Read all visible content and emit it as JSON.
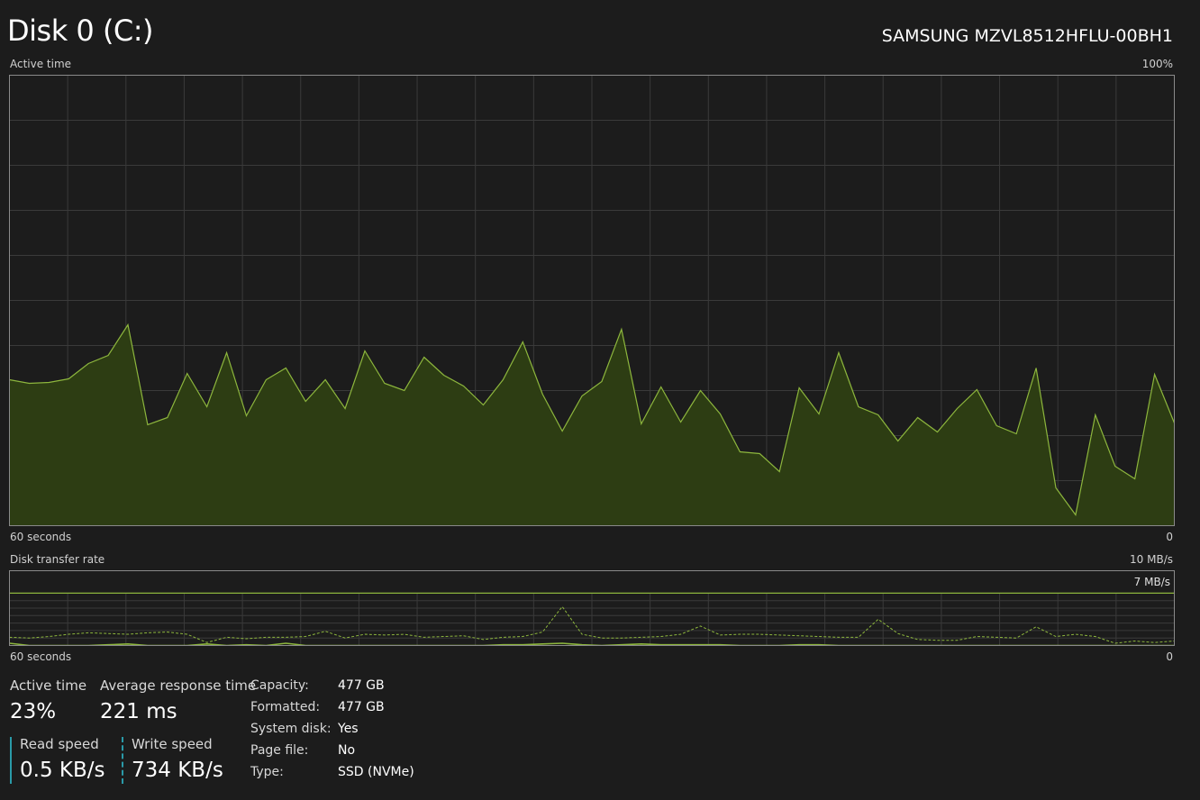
{
  "header": {
    "disk_title": "Disk 0 (C:)",
    "disk_model": "SAMSUNG MZVL8512HFLU-00BH1"
  },
  "active_chart": {
    "label": "Active time",
    "max_label": "100%",
    "time_label": "60 seconds",
    "zero_label": "0"
  },
  "transfer_chart": {
    "label": "Disk transfer rate",
    "max_label": "10 MB/s",
    "ref_label": "7 MB/s",
    "time_label": "60 seconds",
    "zero_label": "0"
  },
  "stats": {
    "active_time_label": "Active time",
    "active_time_value": "23%",
    "avg_response_label": "Average response time",
    "avg_response_value": "221 ms",
    "read_speed_label": "Read speed",
    "read_speed_value": "0.5 KB/s",
    "write_speed_label": "Write speed",
    "write_speed_value": "734 KB/s"
  },
  "properties": [
    {
      "label": "Capacity:",
      "value": "477 GB"
    },
    {
      "label": "Formatted:",
      "value": "477 GB"
    },
    {
      "label": "System disk:",
      "value": "Yes"
    },
    {
      "label": "Page file:",
      "value": "No"
    },
    {
      "label": "Type:",
      "value": "SSD (NVMe)"
    }
  ],
  "colors": {
    "line": "#8db63d",
    "fill": "#2d3d13",
    "grid": "#3a3a3a",
    "border": "#8a8a8a",
    "speed_bar": "#2a9aa8"
  },
  "chart_data": [
    {
      "type": "area",
      "title": "Active time",
      "xlabel": "60 seconds",
      "ylim": [
        0,
        100
      ],
      "x": [
        0,
        1,
        2,
        3,
        4,
        5,
        6,
        7,
        8,
        9,
        10,
        11,
        12,
        13,
        14,
        15,
        16,
        17,
        18,
        19,
        20,
        21,
        22,
        23,
        24,
        25,
        26,
        27,
        28,
        29,
        30,
        31,
        32,
        33,
        34,
        35,
        36,
        37,
        38,
        39,
        40,
        41,
        42,
        43,
        44,
        45,
        46,
        47,
        48,
        49,
        50,
        51,
        52,
        53,
        54,
        55,
        56,
        57,
        58,
        59
      ],
      "values": [
        32.4,
        31.6,
        31.8,
        32.6,
        36,
        37.8,
        44.6,
        22.4,
        24,
        33.8,
        26.4,
        38.4,
        24.4,
        32.4,
        35,
        27.6,
        32.4,
        26,
        38.8,
        31.6,
        30,
        37.4,
        33.4,
        31,
        26.8,
        32.4,
        40.8,
        29.2,
        21,
        28.8,
        32,
        43.6,
        22.6,
        30.8,
        23,
        30,
        24.8,
        16.4,
        16,
        12,
        30.6,
        24.8,
        38.4,
        26.4,
        24.6,
        18.8,
        24,
        20.8,
        26,
        30.2,
        22.2,
        20.4,
        35,
        8.4,
        2.4,
        24.6,
        13.2,
        10.4,
        33.6,
        22.8
      ]
    },
    {
      "type": "line",
      "title": "Disk transfer rate",
      "xlabel": "60 seconds",
      "ylim": [
        0,
        10
      ],
      "reference": 7,
      "x": [
        0,
        1,
        2,
        3,
        4,
        5,
        6,
        7,
        8,
        9,
        10,
        11,
        12,
        13,
        14,
        15,
        16,
        17,
        18,
        19,
        20,
        21,
        22,
        23,
        24,
        25,
        26,
        27,
        28,
        29,
        30,
        31,
        32,
        33,
        34,
        35,
        36,
        37,
        38,
        39,
        40,
        41,
        42,
        43,
        44,
        45,
        46,
        47,
        48,
        49,
        50,
        51,
        52,
        53,
        54,
        55,
        56,
        57,
        58,
        59
      ],
      "series": [
        {
          "values": [
            1.1,
            1,
            1.2,
            1.5,
            1.7,
            1.6,
            1.5,
            1.7,
            1.8,
            1.5,
            0.4,
            1.1,
            0.9,
            1.1,
            1.1,
            1.2,
            1.9,
            1,
            1.5,
            1.4,
            1.5,
            1.1,
            1.2,
            1.3,
            0.8,
            1.1,
            1.2,
            1.8,
            5.2,
            1.5,
            1,
            1,
            1.1,
            1.2,
            1.5,
            2.6,
            1.4,
            1.5,
            1.5,
            1.4,
            1.3,
            1.2,
            1.1,
            1.1,
            3.5,
            1.6,
            0.8,
            0.7,
            0.7,
            1.2,
            1.1,
            1,
            2.5,
            1.2,
            1.5,
            1.2,
            0.3,
            0.6,
            0.4,
            0.6
          ]
        },
        {
          "values": [
            0.3,
            0,
            0,
            0,
            0,
            0.1,
            0.2,
            0,
            0,
            0,
            0.2,
            0,
            0.1,
            0,
            0.3,
            0,
            0,
            0,
            0,
            0,
            0,
            0,
            0,
            0,
            0,
            0.1,
            0.1,
            0.2,
            0.3,
            0.1,
            0,
            0.1,
            0.2,
            0.1,
            0.1,
            0.1,
            0.1,
            0,
            0,
            0,
            0.1,
            0.1,
            0,
            0,
            0,
            0,
            0,
            0,
            0,
            0,
            0,
            0,
            0,
            0,
            0,
            0,
            0,
            0,
            0,
            0
          ]
        }
      ]
    }
  ]
}
